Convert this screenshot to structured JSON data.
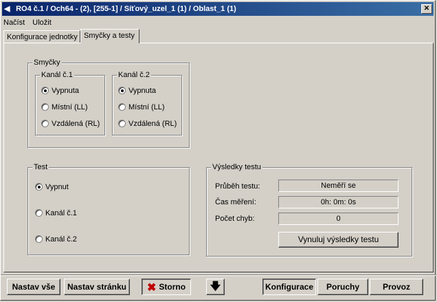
{
  "window": {
    "title": "RO4 č.1 / Och64 - (2), [255-1] / Síťový_uzel_1 (1) / Oblast_1 (1)",
    "close_glyph": "✕",
    "title_icon": "◀"
  },
  "menu": [
    "Načíst",
    "Uložit"
  ],
  "tabs": [
    "Konfigurace jednotky",
    "Smyčky a testy"
  ],
  "smycky": {
    "label": "Smyčky",
    "kanal1": {
      "label": "Kanál č.1",
      "options": [
        "Vypnuta",
        "Místní (LL)",
        "Vzdálená (RL)"
      ],
      "selected": "Vypnuta"
    },
    "kanal2": {
      "label": "Kanál č.2",
      "options": [
        "Vypnuta",
        "Místní (LL)",
        "Vzdálená (RL)"
      ],
      "selected": "Vypnuta"
    }
  },
  "test": {
    "label": "Test",
    "options": [
      "Vypnut",
      "Kanál č.1",
      "Kanál č.2"
    ],
    "selected": "Vypnut"
  },
  "vysledky": {
    "label": "Výsledky testu",
    "rows": [
      {
        "label": "Průběh testu:",
        "value": "Neměří se"
      },
      {
        "label": "Čas měření:",
        "value": "0h: 0m: 0s"
      },
      {
        "label": "Počet chyb:",
        "value": "0"
      }
    ],
    "reset_button": "Vynuluj výsledky testu"
  },
  "footer": {
    "nastav_vse": "Nastav vše",
    "nastav_stranku": "Nastav stránku",
    "storno": "Storno",
    "down_glyph": "🡇",
    "konfigurace": "Konfigurace",
    "poruchy": "Poruchy",
    "provoz": "Provoz"
  }
}
